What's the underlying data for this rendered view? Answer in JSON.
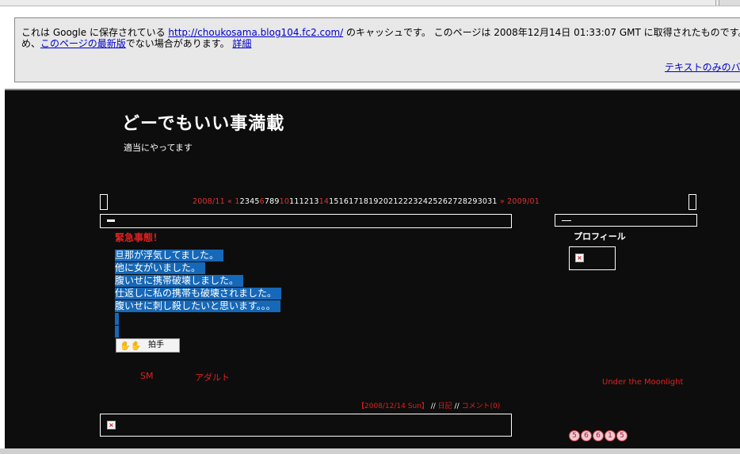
{
  "cache_banner": {
    "line1_prefix": "これは Google に保存されている ",
    "cached_url": "http://choukosama.blog104.fc2.com/",
    "line1_suffix": " のキャッシュです。 このページは 2008年12月14日 01:33:07 GMT に取得されたものです。 そ",
    "line2_prefix": "め、",
    "latest_link": "このページの最新版",
    "line2_mid": "でない場合があります。 ",
    "details_link": "詳細",
    "text_only_link": "テキストのみのバ"
  },
  "blog": {
    "title": "どーでもいい事満載",
    "subtitle": "適当にやってます"
  },
  "calendar": {
    "prev": "2008/11",
    "prev_arrow": "«",
    "days": [
      {
        "d": "1",
        "c": "r"
      },
      {
        "d": "2",
        "c": "w"
      },
      {
        "d": "3",
        "c": "w"
      },
      {
        "d": "4",
        "c": "w"
      },
      {
        "d": "5",
        "c": "w"
      },
      {
        "d": "6",
        "c": "r"
      },
      {
        "d": "7",
        "c": "w"
      },
      {
        "d": "8",
        "c": "w"
      },
      {
        "d": "9",
        "c": "w"
      },
      {
        "d": "10",
        "c": "r"
      },
      {
        "d": "11",
        "c": "w"
      },
      {
        "d": "12",
        "c": "w"
      },
      {
        "d": "13",
        "c": "w"
      },
      {
        "d": "14",
        "c": "r"
      },
      {
        "d": "15",
        "c": "w"
      },
      {
        "d": "16",
        "c": "w"
      },
      {
        "d": "17",
        "c": "w"
      },
      {
        "d": "18",
        "c": "w"
      },
      {
        "d": "19",
        "c": "w"
      },
      {
        "d": "20",
        "c": "w"
      },
      {
        "d": "21",
        "c": "w"
      },
      {
        "d": "22",
        "c": "w"
      },
      {
        "d": "23",
        "c": "w"
      },
      {
        "d": "24",
        "c": "w"
      },
      {
        "d": "25",
        "c": "w"
      },
      {
        "d": "26",
        "c": "w"
      },
      {
        "d": "27",
        "c": "w"
      },
      {
        "d": "28",
        "c": "w"
      },
      {
        "d": "29",
        "c": "w"
      },
      {
        "d": "30",
        "c": "w"
      },
      {
        "d": "31",
        "c": "w"
      }
    ],
    "next_arrow": "»",
    "next": "2009/01"
  },
  "entry": {
    "title": "緊急事態！",
    "lines": [
      "旦那が浮気してました。",
      "他に女がいました。",
      "腹いせに携帯破壊しました。",
      "仕返しに私の携帯も破壊されました。",
      "腹いせに刺し殺したいと思います。。。"
    ],
    "clap_label": "拍手",
    "clap_icon": "clapping-hands-icon",
    "categories": [
      "SM",
      "アダルト"
    ],
    "date": "【2008/12/14 Sun】",
    "sep": " // ",
    "category_link": "日記",
    "comments": "コメント(0)"
  },
  "sidebar": {
    "profile_heading": "プロフィール",
    "footer_link": "Under the Moonlight",
    "counter_digits": [
      "5",
      "6",
      "6",
      "1",
      "5"
    ]
  },
  "colors": {
    "accent_red": "#e02020",
    "selection_blue": "#1668b8",
    "blog_bg": "#0d0d0d",
    "banner_bg": "#e8e8e8",
    "link_blue": "#0000cc"
  }
}
